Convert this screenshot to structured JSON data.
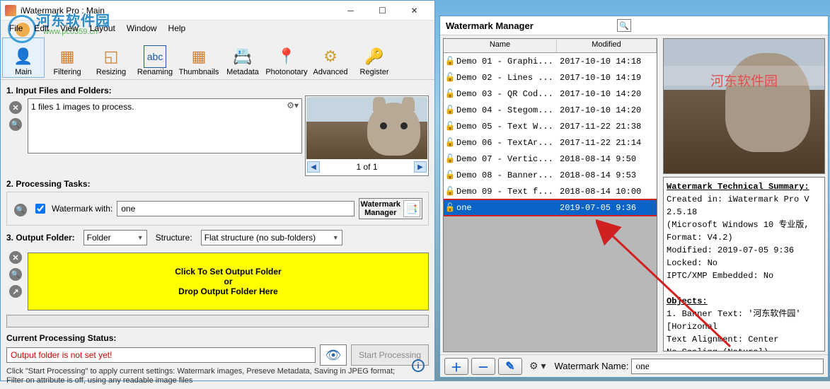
{
  "main": {
    "title": "iWatermark Pro : Main",
    "overlay_text": "河东软件园",
    "overlay_url": "www.pc0359.cn",
    "menus": [
      "File",
      "Edit",
      "View",
      "Layout",
      "Window",
      "Help"
    ],
    "tools": [
      {
        "label": "Main",
        "icon": "👤"
      },
      {
        "label": "Filtering",
        "icon": "▦"
      },
      {
        "label": "Resizing",
        "icon": "◱"
      },
      {
        "label": "Renaming",
        "icon": "ᴀʙᴄ"
      },
      {
        "label": "Thumbnails",
        "icon": "▦▦"
      },
      {
        "label": "Metadata",
        "icon": "🗂"
      },
      {
        "label": "Photonotary",
        "icon": "📍"
      },
      {
        "label": "Advanced",
        "icon": "⚙"
      },
      {
        "label": "Register",
        "icon": "🔑"
      }
    ],
    "input_title": "1. Input Files and Folders:",
    "input_summary": "1 files 1 images to process.",
    "thumb_pager": "1 of 1",
    "tasks_title": "2. Processing Tasks:",
    "watermark_label": "Watermark with:",
    "watermark_value": "one",
    "wm_mgr_btn": "Watermark\nManager",
    "output_title": "3. Output Folder:",
    "folder_combo": "Folder",
    "structure_label": "Structure:",
    "structure_combo": "Flat structure (no sub-folders)",
    "drop_line1": "Click  To Set Output Folder",
    "drop_line2": "or",
    "drop_line3": "Drop Output Folder Here",
    "status_title": "Current Processing Status:",
    "status_text": "Output folder is not set yet!",
    "start_btn": "Start Processing",
    "hint": "Click \"Start Processing\" to apply current settings: Watermark images, Preseve Metadata, Saving in JPEG format;\nFilter on attribute is off, using any readable image files"
  },
  "wm": {
    "title": "Watermark Manager",
    "col_name": "Name",
    "col_modified": "Modified",
    "rows": [
      {
        "name": "Demo 01 - Graphi...",
        "date": "2017-10-10 14:18"
      },
      {
        "name": "Demo 02 - Lines ...",
        "date": "2017-10-10 14:19"
      },
      {
        "name": "Demo 03 - QR Cod...",
        "date": "2017-10-10 14:20"
      },
      {
        "name": "Demo 04 - Stegom...",
        "date": "2017-10-10 14:20"
      },
      {
        "name": "Demo 05 - Text W...",
        "date": "2017-11-22 21:38"
      },
      {
        "name": "Demo 06 - TextAr...",
        "date": "2017-11-22 21:14"
      },
      {
        "name": "Demo 07 - Vertic...",
        "date": "2018-08-14 9:50"
      },
      {
        "name": "Demo 08 - Banner...",
        "date": "2018-08-14 9:53"
      },
      {
        "name": "Demo 09 - Text f...",
        "date": "2018-08-14 10:00"
      },
      {
        "name": "one",
        "date": "2019-07-05 9:36",
        "selected": true
      }
    ],
    "preview_text": "河东软件园",
    "summary_title": "Watermark Technical Summary:",
    "summary_lines": [
      "Created in: iWatermark Pro V 2.5.18",
      "(Microsoft Windows 10 专业版, Format: V4.2)",
      "Modified: 2019-07-05 9:36",
      "Locked: No",
      "IPTC/XMP Embedded: No",
      "",
      "Objects:",
      "1. Banner Text: '河东软件园'",
      "   [Horizonal",
      "   Text Alignment: Center",
      "   No Scaling (Natural),"
    ],
    "name_label": "Watermark Name:",
    "name_value": "one"
  }
}
